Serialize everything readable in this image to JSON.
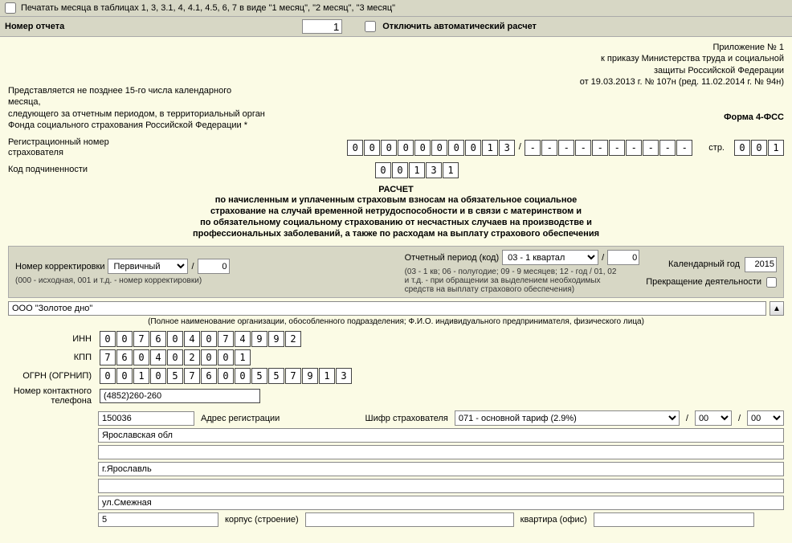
{
  "topbar": {
    "print_months_label": "Печатать месяца в таблицах 1, 3, 3.1, 4, 4.1, 4.5, 6, 7 в виде \"1 месяц\", \"2 месяц\", \"3 месяц\"",
    "report_no_label": "Номер отчета",
    "report_no_value": "1",
    "disable_autocalc_label": "Отключить автоматический расчет"
  },
  "header": {
    "left1": "Представляется не позднее 15-го числа календарного месяца,",
    "left2": "следующего за отчетным периодом, в территориальный орган",
    "left3": "Фонда социального страхования Российской Федерации *",
    "right1": "Приложение № 1",
    "right2": "к приказу Министерства труда и социальной",
    "right3": "защиты Российской Федерации",
    "right4": "от 19.03.2013 г. № 107н (ред. 11.02.2014 г. № 94н)",
    "form_name": "Форма 4-ФСС"
  },
  "reg": {
    "reg_no_label": "Регистрационный номер страхователя",
    "reg_no": [
      "0",
      "0",
      "0",
      "0",
      "0",
      "0",
      "0",
      "0",
      "1",
      "3",
      "/",
      "-",
      "-",
      "-",
      "-",
      "-",
      "-",
      "-",
      "-",
      "-",
      "-"
    ],
    "page_label": "стр.",
    "page": [
      "0",
      "0",
      "1"
    ],
    "subord_label": "Код подчиненности",
    "subord": [
      "0",
      "0",
      "1",
      "3",
      "1"
    ]
  },
  "title": {
    "t1": "РАСЧЕТ",
    "t2": "по начисленным и уплаченным страховым взносам на обязательное социальное",
    "t3": "страхование на случай временной нетрудоспособности и в связи с материнством и",
    "t4": "по обязательному социальному страхованию от несчастных случаев на производстве и",
    "t5": "профессиональных заболеваний, а также по расходам на выплату страхового обеспечения"
  },
  "ctl": {
    "corr_no_label": "Номер корректировки",
    "corr_type": "Первичный",
    "corr_no": "0",
    "corr_hint": "(000 - исходная, 001 и т.д. - номер корректировки)",
    "period_label": "Отчетный период (код)",
    "period_value": "03 - 1 квартал",
    "period_suffix": "0",
    "period_hint1": "(03 - 1 кв; 06 - полугодие; 09 - 9 месяцев; 12 - год / 01, 02",
    "period_hint2": "и т.д. - при обращении за выделением необходимых",
    "period_hint3": "средств на выплату страхового обеспечения)",
    "year_label": "Календарный год",
    "year": "2015",
    "cease_label": "Прекращение деятельности"
  },
  "org": {
    "name": "ООО \"Золотое дно\"",
    "hint": "(Полное наименование организации, обособленного подразделения; Ф.И.О. индивидуального предпринимателя, физического лица)"
  },
  "codes": {
    "inn_label": "ИНН",
    "inn": [
      "0",
      "0",
      "7",
      "6",
      "0",
      "4",
      "0",
      "7",
      "4",
      "9",
      "9",
      "2"
    ],
    "kpp_label": "КПП",
    "kpp": [
      "7",
      "6",
      "0",
      "4",
      "0",
      "2",
      "0",
      "0",
      "1"
    ],
    "ogrn_label": "ОГРН (ОГРНИП)",
    "ogrn": [
      "0",
      "0",
      "1",
      "0",
      "5",
      "7",
      "6",
      "0",
      "0",
      "5",
      "5",
      "7",
      "9",
      "1",
      "3"
    ],
    "phone_label": "Номер контактного телефона",
    "phone": "(4852)260-260"
  },
  "addr": {
    "index": "150036",
    "index_label": "Адрес регистрации",
    "tariff_label": "Шифр страхователя",
    "tariff": "071 - основной тариф (2.9%)",
    "tariff_a": "00",
    "tariff_b": "00",
    "region": "Ярославская обл",
    "city": "г.Ярославль",
    "street": "ул.Смежная",
    "house": "5",
    "korpus_label": "корпус (строение)",
    "korpus": "",
    "apt_label": "квартира (офис)",
    "apt": ""
  }
}
